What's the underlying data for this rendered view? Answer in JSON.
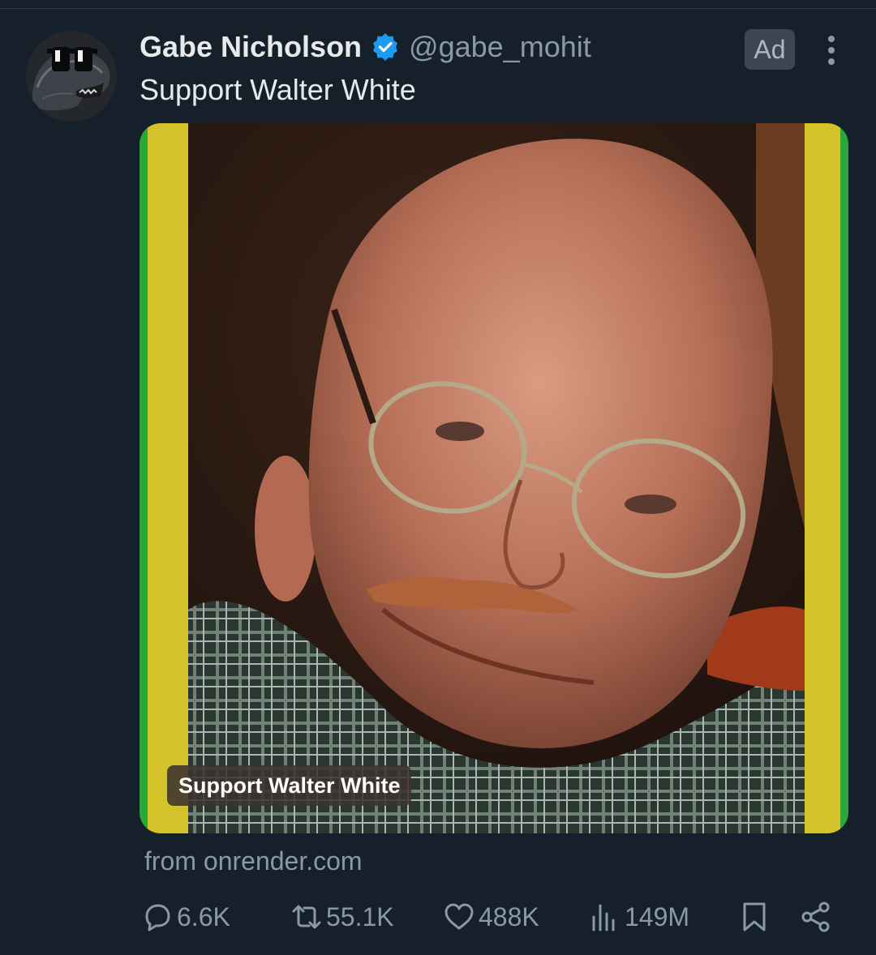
{
  "post": {
    "author": {
      "display_name": "Gabe Nicholson",
      "handle": "@gabe_mohit",
      "verified": true,
      "avatar_icon": "godzilla-sunglasses-avatar"
    },
    "ad_label": "Ad",
    "text": "Support Walter White",
    "media": {
      "caption": "Support Walter White",
      "border_colors": [
        "#d4c22a",
        "#2aa83a"
      ]
    },
    "source": "from onrender.com",
    "actions": {
      "replies": "6.6K",
      "reposts": "55.1K",
      "likes": "488K",
      "views": "149M"
    }
  },
  "theme": {
    "background": "#15202b",
    "text_primary": "#e7e9ea",
    "text_secondary": "#8b98a5",
    "verified_blue": "#1d9bf0"
  }
}
